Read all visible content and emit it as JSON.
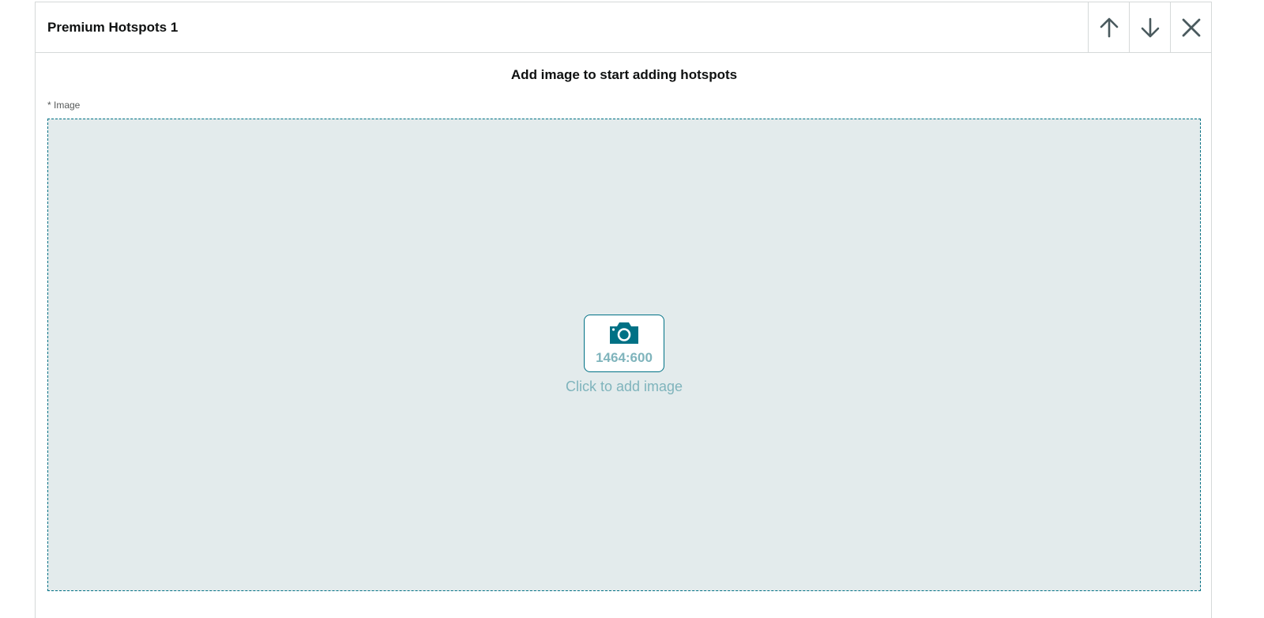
{
  "panel": {
    "title": "Premium Hotspots 1",
    "actions": [
      {
        "name": "move-up",
        "icon": "arrow-up-icon"
      },
      {
        "name": "move-down",
        "icon": "arrow-down-icon"
      },
      {
        "name": "remove",
        "icon": "close-icon"
      }
    ]
  },
  "body": {
    "heading": "Add image to start adding hotspots",
    "image_field_label": "* Image",
    "dropzone": {
      "ratio": "1464:600",
      "icon": "camera-icon",
      "cta": "Click to add image"
    }
  },
  "colors": {
    "accent": "#007185",
    "dropzone_bg": "#e3ebec",
    "muted_teal_text": "#7fb4bc",
    "icon_gray": "#4a5a5e",
    "border": "#d5d9d9"
  }
}
